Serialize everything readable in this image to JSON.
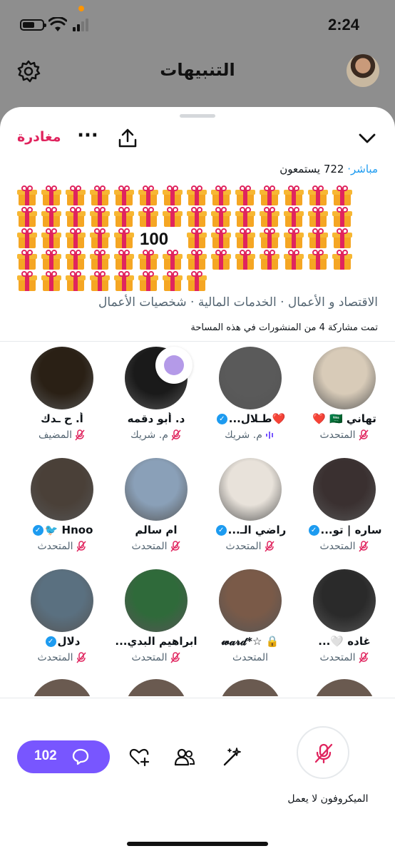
{
  "status_bar": {
    "time": "2:24"
  },
  "header": {
    "title": "التنبيهات",
    "settings_icon": "gear-icon"
  },
  "space": {
    "leave_label": "مغادرة",
    "live_label": "مباشر",
    "listeners_text": "722 يستمعون",
    "gift_count": "100",
    "topics": "الاقتصاد و الأعمال · الخدمات المالية · شخصيات الأعمال",
    "shared_posts": "تمت مشاركة 4 من المنشورات في هذه المساحة"
  },
  "participants": [
    {
      "name": "تهاني 🇸🇦 ❤️",
      "role": "المتحدث",
      "verified": false,
      "mic": "off",
      "avatar_color": "#d8cbb8"
    },
    {
      "name": "❤️طـلال...",
      "role": "م. شريك",
      "verified": true,
      "mic": "speaking",
      "avatar_color": "#5a5a5a"
    },
    {
      "name": "د. أبو دقمه",
      "role": "م. شريك",
      "verified": false,
      "mic": "off",
      "avatar_color": "#1a1a1a"
    },
    {
      "name": "أ. ح ـدك",
      "role": "المضيف",
      "verified": false,
      "mic": "off",
      "avatar_color": "#2a2015"
    },
    {
      "name": "ساره | تو...",
      "role": "المتحدث",
      "verified": true,
      "mic": "off",
      "avatar_color": "#3a3030"
    },
    {
      "name": "راضي الـ...",
      "role": "المتحدث",
      "verified": true,
      "mic": "off",
      "avatar_color": "#e8e2da"
    },
    {
      "name": "ام سالم",
      "role": "المتحدث",
      "verified": false,
      "mic": "off",
      "avatar_color": "#8aa0b8"
    },
    {
      "name": "Hnoo 🐦",
      "role": "المتحدث",
      "verified": true,
      "mic": "off",
      "avatar_color": "#4a4038"
    },
    {
      "name": "غاده 🤍...",
      "role": "المتحدث",
      "verified": false,
      "mic": "off",
      "avatar_color": "#2a2a2a"
    },
    {
      "name": "🔒 ☆*𝔀𝓪𝓻𝓭",
      "role": "المتحدث",
      "verified": false,
      "mic": "none",
      "avatar_color": "#7a5a48"
    },
    {
      "name": "ابراهيم البدي...",
      "role": "المتحدث",
      "verified": false,
      "mic": "off",
      "avatar_color": "#2f6a3a"
    },
    {
      "name": "دلال",
      "role": "المتحدث",
      "verified": true,
      "mic": "off",
      "avatar_color": "#5a7080"
    }
  ],
  "bottom_bar": {
    "chat_count": "102",
    "mic_status": "الميكروفون لا يعمل"
  },
  "colors": {
    "accent": "#7856ff",
    "danger": "#e0245e",
    "link": "#1d9bf0",
    "muted": "#536471",
    "mic_off": "#e0245e"
  }
}
